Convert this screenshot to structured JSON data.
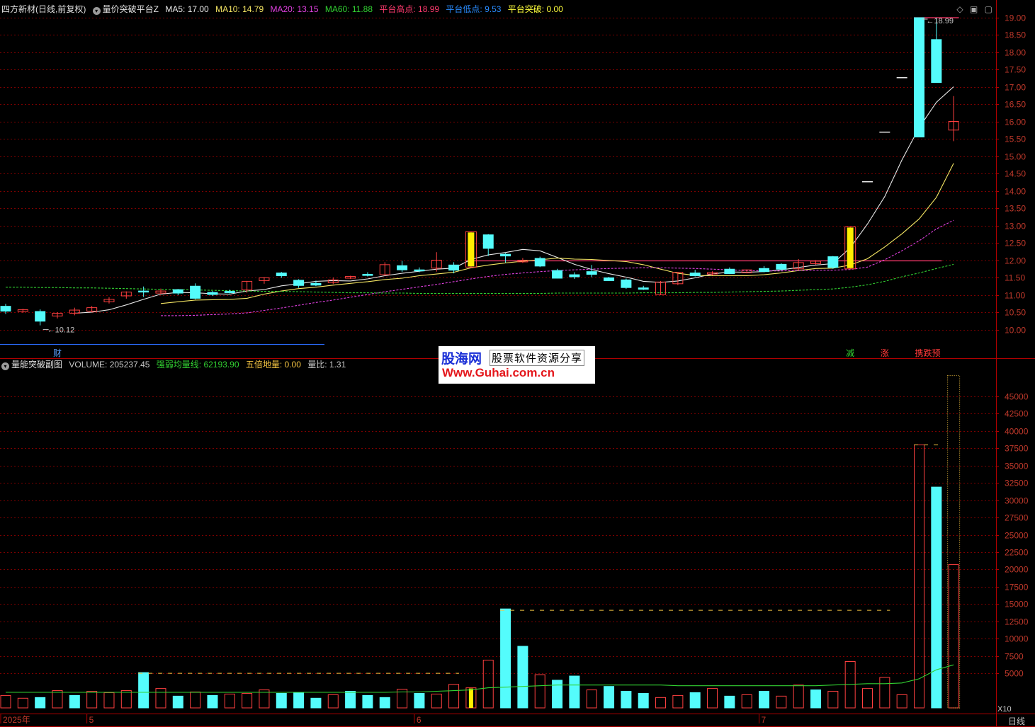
{
  "header": {
    "stock_name": "四方新材(日线,前复权)",
    "indicator_name": "量价突破平台Z",
    "items": [
      {
        "label": "MA5: 17.00",
        "color": "#e8e8e8"
      },
      {
        "label": "MA10: 14.79",
        "color": "#f5e663"
      },
      {
        "label": "MA20: 13.15",
        "color": "#e040e0"
      },
      {
        "label": "MA60: 11.88",
        "color": "#32d232"
      },
      {
        "label": "平台高点: 18.99",
        "color": "#ff3a6e"
      },
      {
        "label": "平台低点: 9.53",
        "color": "#2a8cff"
      },
      {
        "label": "平台突破: 0.00",
        "color": "#ffff3c"
      }
    ]
  },
  "sub_header": {
    "indicator_name": "量能突破副图",
    "items": [
      {
        "label": "VOLUME: 205237.45",
        "color": "#c8c8c8"
      },
      {
        "label": "强弱均量线: 62193.90",
        "color": "#32d232"
      },
      {
        "label": "五倍地量: 0.00",
        "color": "#f5c542"
      },
      {
        "label": "量比: 1.31",
        "color": "#c8c8c8"
      }
    ]
  },
  "corner_icons": [
    "diamond-icon",
    "window-icon",
    "maximize-icon"
  ],
  "watermark": {
    "brand": "股海网",
    "slogan": "股票软件资源分享",
    "url": "Www.Guhai.com.cn"
  },
  "period_label": "日线",
  "colors": {
    "up": "#ff4040",
    "down": "#54fcfc",
    "grid": "#7a0000",
    "axis": "#b00000",
    "breakout": "#ffee00",
    "platform": "#ff3a6e"
  },
  "chart_data": [
    {
      "type": "candlestick",
      "title": "",
      "ylim": [
        9.6,
        19.2
      ],
      "yticks": [
        10.0,
        10.5,
        11.0,
        11.5,
        12.0,
        12.5,
        13.0,
        13.5,
        14.0,
        14.5,
        15.0,
        15.5,
        16.0,
        16.5,
        17.0,
        17.5,
        18.0,
        18.5,
        19.0
      ],
      "x_labels": [
        {
          "index": 0,
          "label": "2025年"
        },
        {
          "index": 5,
          "label": "5"
        },
        {
          "index": 24,
          "label": "6"
        },
        {
          "index": 44,
          "label": "7"
        }
      ],
      "candles": [
        {
          "o": 10.67,
          "h": 10.74,
          "c": 10.53,
          "l": 10.45
        },
        {
          "o": 10.52,
          "h": 10.6,
          "c": 10.57,
          "l": 10.48
        },
        {
          "o": 10.52,
          "h": 10.58,
          "c": 10.24,
          "l": 10.12
        },
        {
          "o": 10.39,
          "h": 10.5,
          "c": 10.47,
          "l": 10.32
        },
        {
          "o": 10.47,
          "h": 10.63,
          "c": 10.56,
          "l": 10.41
        },
        {
          "o": 10.53,
          "h": 10.68,
          "c": 10.63,
          "l": 10.5
        },
        {
          "o": 10.8,
          "h": 10.93,
          "c": 10.87,
          "l": 10.75
        },
        {
          "o": 10.97,
          "h": 11.1,
          "c": 11.08,
          "l": 10.89
        },
        {
          "o": 11.11,
          "h": 11.24,
          "c": 11.09,
          "l": 10.94
        },
        {
          "o": 11.05,
          "h": 11.18,
          "c": 11.11,
          "l": 11.02
        },
        {
          "o": 11.15,
          "h": 11.17,
          "c": 11.05,
          "l": 10.99
        },
        {
          "o": 11.25,
          "h": 11.33,
          "c": 10.9,
          "l": 10.87
        },
        {
          "o": 11.07,
          "h": 11.11,
          "c": 11.01,
          "l": 10.97
        },
        {
          "o": 11.1,
          "h": 11.15,
          "c": 11.06,
          "l": 11.04
        },
        {
          "o": 11.14,
          "h": 11.4,
          "c": 11.39,
          "l": 11.06
        },
        {
          "o": 11.41,
          "h": 11.51,
          "c": 11.49,
          "l": 11.32
        },
        {
          "o": 11.63,
          "h": 11.66,
          "c": 11.55,
          "l": 11.49
        },
        {
          "o": 11.42,
          "h": 11.45,
          "c": 11.27,
          "l": 11.2
        },
        {
          "o": 11.33,
          "h": 11.41,
          "c": 11.28,
          "l": 11.25
        },
        {
          "o": 11.35,
          "h": 11.5,
          "c": 11.43,
          "l": 11.31
        },
        {
          "o": 11.48,
          "h": 11.55,
          "c": 11.53,
          "l": 11.46
        },
        {
          "o": 11.59,
          "h": 11.65,
          "c": 11.56,
          "l": 11.53
        },
        {
          "o": 11.58,
          "h": 11.94,
          "c": 11.87,
          "l": 11.55
        },
        {
          "o": 11.84,
          "h": 11.98,
          "c": 11.72,
          "l": 11.66
        },
        {
          "o": 11.72,
          "h": 11.79,
          "c": 11.7,
          "l": 11.65
        },
        {
          "o": 11.77,
          "h": 12.23,
          "c": 12.0,
          "l": 11.67
        },
        {
          "o": 11.86,
          "h": 11.94,
          "c": 11.71,
          "l": 11.62
        },
        {
          "o": 11.8,
          "h": 12.82,
          "c": 12.82,
          "l": 11.78
        },
        {
          "o": 12.73,
          "h": 12.75,
          "c": 12.34,
          "l": 12.12
        },
        {
          "o": 12.17,
          "h": 12.2,
          "c": 12.12,
          "l": 11.93
        },
        {
          "o": 11.95,
          "h": 12.06,
          "c": 12.0,
          "l": 11.92
        },
        {
          "o": 12.05,
          "h": 12.1,
          "c": 11.83,
          "l": 11.8
        },
        {
          "o": 11.7,
          "h": 11.75,
          "c": 11.48,
          "l": 11.47
        },
        {
          "o": 11.58,
          "h": 11.65,
          "c": 11.52,
          "l": 11.46
        },
        {
          "o": 11.67,
          "h": 11.86,
          "c": 11.59,
          "l": 11.51
        },
        {
          "o": 11.49,
          "h": 11.52,
          "c": 11.41,
          "l": 11.4
        },
        {
          "o": 11.43,
          "h": 11.47,
          "c": 11.21,
          "l": 11.17
        },
        {
          "o": 11.2,
          "h": 11.26,
          "c": 11.16,
          "l": 11.14
        },
        {
          "o": 11.01,
          "h": 11.4,
          "c": 11.37,
          "l": 10.99
        },
        {
          "o": 11.32,
          "h": 11.65,
          "c": 11.65,
          "l": 11.28
        },
        {
          "o": 11.63,
          "h": 11.72,
          "c": 11.55,
          "l": 11.53
        },
        {
          "o": 11.6,
          "h": 11.68,
          "c": 11.64,
          "l": 11.56
        },
        {
          "o": 11.74,
          "h": 11.79,
          "c": 11.61,
          "l": 11.6
        },
        {
          "o": 11.64,
          "h": 11.73,
          "c": 11.72,
          "l": 11.62
        },
        {
          "o": 11.76,
          "h": 11.83,
          "c": 11.67,
          "l": 11.65
        },
        {
          "o": 11.88,
          "h": 11.91,
          "c": 11.74,
          "l": 11.71
        },
        {
          "o": 11.75,
          "h": 12.03,
          "c": 11.93,
          "l": 11.71
        },
        {
          "o": 11.9,
          "h": 12.0,
          "c": 11.97,
          "l": 11.87
        },
        {
          "o": 12.1,
          "h": 12.12,
          "c": 11.79,
          "l": 11.75
        },
        {
          "o": 11.75,
          "h": 12.96,
          "c": 12.96,
          "l": 11.74
        },
        {
          "o": 14.26,
          "h": 14.26,
          "c": 14.26,
          "l": 14.26
        },
        {
          "o": 15.69,
          "h": 15.69,
          "c": 15.69,
          "l": 15.69
        },
        {
          "o": 17.26,
          "h": 17.26,
          "c": 17.26,
          "l": 17.26
        },
        {
          "o": 18.99,
          "h": 18.99,
          "c": 15.55,
          "l": 15.55
        },
        {
          "o": 18.36,
          "h": 18.99,
          "c": 17.12,
          "l": 17.12
        },
        {
          "o": 15.75,
          "h": 16.73,
          "c": 16.0,
          "l": 15.43
        }
      ],
      "breakout_bars": [
        27,
        49
      ],
      "limit_up_bars": [
        50,
        51,
        52
      ],
      "annotations": [
        {
          "index": 2,
          "price": 10.12,
          "label": "10.12"
        },
        {
          "index": 53,
          "price": 18.99,
          "label": "18.99"
        }
      ],
      "platform_lines": [
        {
          "price": 11.98,
          "from": 27,
          "to": 54
        },
        {
          "price": 18.99,
          "from": 53,
          "to": 55
        }
      ],
      "series": [
        {
          "name": "MA5",
          "color": "#e8e8e8",
          "values": [
            null,
            null,
            null,
            null,
            10.47,
            10.5,
            10.57,
            10.71,
            10.87,
            11.02,
            11.07,
            11.06,
            11.03,
            11.02,
            11.11,
            11.15,
            11.26,
            11.32,
            11.39,
            11.41,
            11.4,
            11.46,
            11.55,
            11.62,
            11.68,
            11.74,
            11.77,
            12.02,
            12.15,
            12.22,
            12.31,
            12.27,
            12.08,
            11.88,
            11.73,
            11.61,
            11.51,
            11.39,
            11.36,
            11.4,
            11.49,
            11.6,
            11.66,
            11.65,
            11.67,
            11.72,
            11.79,
            11.86,
            11.9,
            12.36,
            13.04,
            13.83,
            14.89,
            15.82,
            16.55,
            17.0
          ]
        },
        {
          "name": "MA10",
          "color": "#f5e663",
          "values": [
            null,
            null,
            null,
            null,
            null,
            null,
            null,
            null,
            null,
            10.75,
            10.8,
            10.85,
            10.86,
            10.87,
            10.9,
            11.02,
            11.11,
            11.18,
            11.22,
            11.28,
            11.33,
            11.38,
            11.44,
            11.48,
            11.55,
            11.6,
            11.65,
            11.78,
            11.86,
            11.92,
            11.97,
            12.01,
            12.06,
            12.03,
            12.02,
            11.99,
            11.96,
            11.87,
            11.74,
            11.62,
            11.56,
            11.55,
            11.55,
            11.55,
            11.58,
            11.63,
            11.7,
            11.76,
            11.77,
            11.86,
            12.04,
            12.38,
            12.76,
            13.19,
            13.81,
            14.79
          ]
        },
        {
          "name": "MA20",
          "color": "#e040e0",
          "values": [
            null,
            null,
            null,
            null,
            null,
            null,
            null,
            null,
            null,
            10.4,
            10.4,
            10.41,
            10.43,
            10.45,
            10.48,
            10.55,
            10.62,
            10.7,
            10.78,
            10.85,
            10.93,
            11.01,
            11.09,
            11.16,
            11.23,
            11.3,
            11.38,
            11.46,
            11.53,
            11.59,
            11.63,
            11.67,
            11.7,
            11.72,
            11.74,
            11.76,
            11.77,
            11.78,
            11.78,
            11.77,
            11.76,
            11.74,
            11.72,
            11.7,
            11.69,
            11.69,
            11.7,
            11.71,
            11.71,
            11.73,
            11.8,
            12.01,
            12.27,
            12.56,
            12.9,
            13.15
          ]
        },
        {
          "name": "MA60",
          "color": "#32d232",
          "values": [
            11.22,
            11.22,
            11.21,
            11.21,
            11.2,
            11.2,
            11.19,
            11.18,
            11.17,
            11.16,
            11.15,
            11.14,
            11.13,
            11.12,
            11.11,
            11.1,
            11.1,
            11.09,
            11.08,
            11.07,
            11.06,
            11.06,
            11.05,
            11.05,
            11.04,
            11.04,
            11.04,
            11.04,
            11.04,
            11.04,
            11.04,
            11.04,
            11.05,
            11.05,
            11.05,
            11.05,
            11.05,
            11.06,
            11.06,
            11.06,
            11.07,
            11.07,
            11.08,
            11.09,
            11.1,
            11.11,
            11.13,
            11.15,
            11.17,
            11.22,
            11.29,
            11.39,
            11.52,
            11.63,
            11.76,
            11.88
          ]
        }
      ]
    },
    {
      "type": "bar",
      "title": "",
      "ylim": [
        0,
        49000
      ],
      "yticks": [
        5000,
        7500,
        10000,
        12500,
        15000,
        17500,
        20000,
        22500,
        25000,
        27500,
        30000,
        32500,
        35000,
        37500,
        40000,
        42500,
        45000
      ],
      "unit_label": "X10",
      "volumes": [
        1800,
        1400,
        1500,
        2500,
        1800,
        2400,
        2200,
        2500,
        5100,
        2800,
        1700,
        2300,
        1800,
        2000,
        2100,
        2600,
        2100,
        2200,
        1400,
        1900,
        2400,
        1800,
        1500,
        2700,
        2100,
        2000,
        3400,
        2900,
        6900,
        14300,
        8900,
        4800,
        4000,
        4600,
        2600,
        3100,
        2400,
        2100,
        1500,
        1800,
        2200,
        2800,
        1700,
        1900,
        2400,
        1700,
        3300,
        2600,
        2400,
        6700,
        2800,
        4400,
        1900,
        38000,
        31900,
        20700
      ],
      "up_flags": [
        1,
        1,
        0,
        1,
        0,
        1,
        1,
        1,
        0,
        1,
        0,
        1,
        0,
        1,
        1,
        1,
        0,
        0,
        0,
        1,
        0,
        0,
        0,
        1,
        0,
        1,
        1,
        1,
        1,
        0,
        0,
        1,
        0,
        0,
        1,
        0,
        0,
        0,
        1,
        1,
        0,
        1,
        0,
        1,
        0,
        1,
        1,
        0,
        1,
        1,
        1,
        1,
        1,
        1,
        0,
        1
      ],
      "highlight_bar": 27,
      "five_fold_lines": [
        {
          "value": 5000,
          "from": 8,
          "to": 26
        },
        {
          "value": 14100,
          "from": 29,
          "to": 51
        },
        {
          "value": 38000,
          "from": 53,
          "to": 54
        }
      ],
      "forecast_bar": {
        "index": 55,
        "value": 48000
      },
      "series": [
        {
          "name": "强弱均量线",
          "color": "#32d232",
          "values": [
            2250,
            2250,
            2250,
            2250,
            2250,
            2250,
            2250,
            2250,
            2250,
            2250,
            2250,
            2250,
            2250,
            2250,
            2250,
            2250,
            2250,
            2250,
            2250,
            2250,
            2250,
            2250,
            2250,
            2300,
            2300,
            2400,
            2500,
            2600,
            2900,
            3000,
            3100,
            3200,
            3300,
            3300,
            3300,
            3300,
            3300,
            3300,
            3300,
            3200,
            3200,
            3200,
            3200,
            3200,
            3200,
            3200,
            3200,
            3200,
            3300,
            3400,
            3500,
            3500,
            3600,
            4200,
            5500,
            6219
          ]
        }
      ]
    }
  ],
  "status_tags": [
    {
      "label": "财",
      "color": "#5aa0ff",
      "index": 3
    },
    {
      "label": "减",
      "color": "#32d232",
      "index": 49
    },
    {
      "label": "涨",
      "color": "#ff3a3a",
      "index": 51
    },
    {
      "label": "携跌预",
      "color": "#ff3a3a",
      "index": 53
    }
  ]
}
